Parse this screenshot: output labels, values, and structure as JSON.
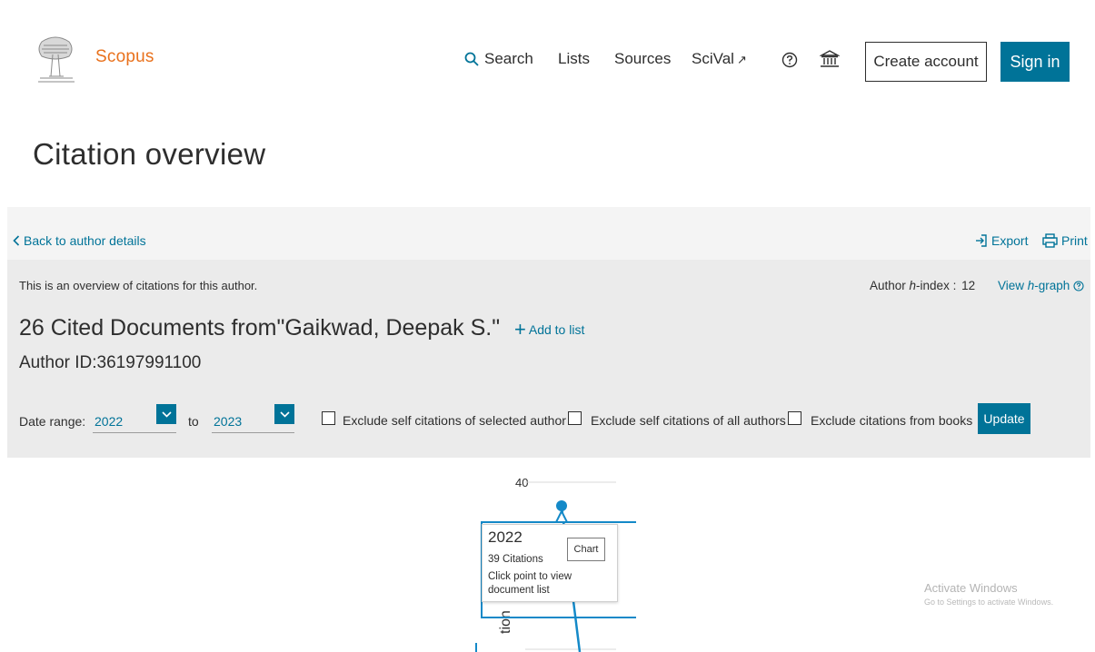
{
  "header": {
    "brand": "Scopus",
    "nav": {
      "search": "Search",
      "lists": "Lists",
      "sources": "Sources",
      "scival": "SciVal",
      "scival_arrow": "↗"
    },
    "create_account": "Create account",
    "sign_in": "Sign in",
    "accent_color": "#007398",
    "brand_color": "#e9711c"
  },
  "page": {
    "title": "Citation overview"
  },
  "toolbar": {
    "back": "Back to author details",
    "export": "Export",
    "print": "Print"
  },
  "overview": {
    "intro": "This is an overview of citations for this author.",
    "hindex_label_pre": "Author ",
    "hindex_label_h": "h",
    "hindex_label_post": "-index : ",
    "hindex_value": "12",
    "hgraph_pre": "View ",
    "hgraph_h": "h",
    "hgraph_post": "-graph",
    "heading": "26 Cited Documents from\"Gaikwad, Deepak S.\"",
    "add_to_list": "Add to list",
    "author_id": "Author ID:36197991100"
  },
  "filters": {
    "date_range_label": "Date range:",
    "from_year": "2022",
    "to_label": "to",
    "to_year": "2023",
    "exclude_self_selected": "Exclude self citations of selected author",
    "exclude_self_all": "Exclude self citations of all authors",
    "exclude_books": "Exclude citations from books",
    "update": "Update"
  },
  "chart_data": {
    "type": "line",
    "x": [
      "2022"
    ],
    "y_tick_labels": [
      "40"
    ],
    "series": [
      {
        "values": [
          39
        ]
      }
    ],
    "ylabel_partial": "tion",
    "tooltip": {
      "year": "2022",
      "citations": "39 Citations",
      "hint": "Click point to view document list",
      "button": "Chart"
    }
  },
  "watermark": {
    "line1": "Activate Windows",
    "line2": "Go to Settings to activate Windows."
  }
}
